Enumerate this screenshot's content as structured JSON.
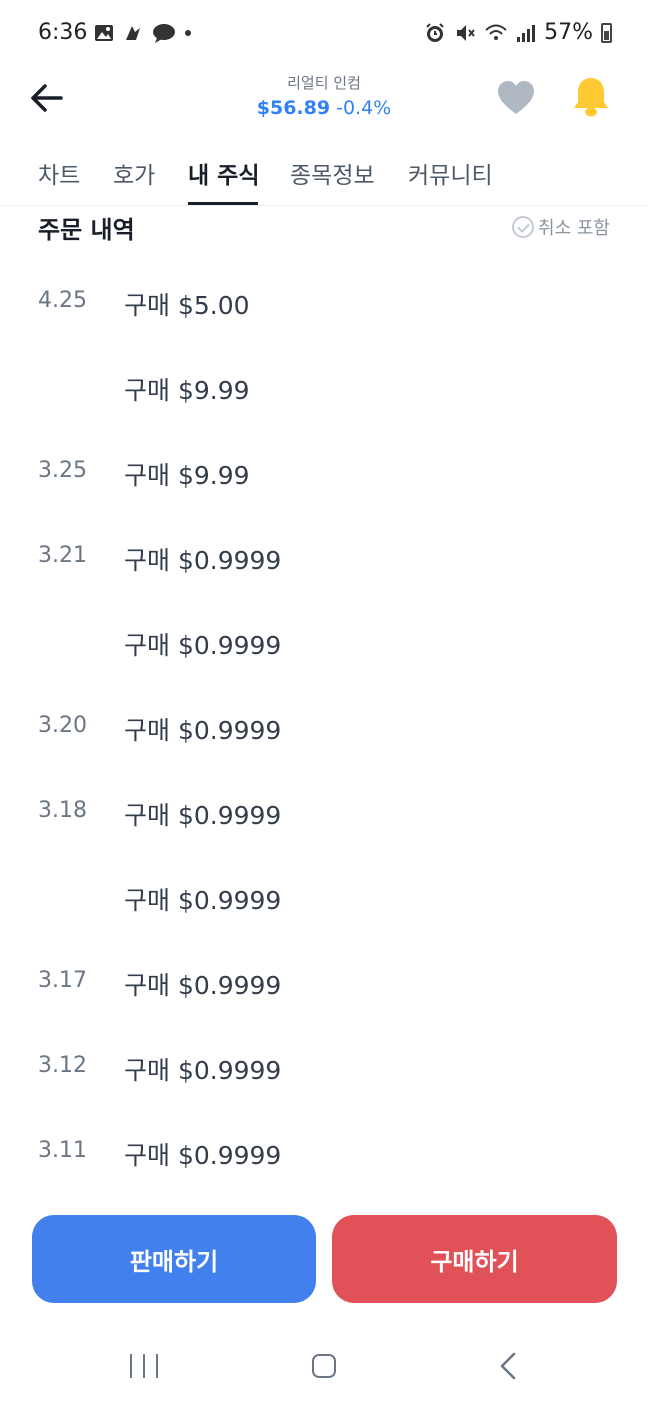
{
  "status_bar": {
    "time": "6:36",
    "battery": "57%"
  },
  "header": {
    "stock_name": "리얼티 인컴",
    "price": "$56.89",
    "change": "-0.4%",
    "price_color": "#3182f6",
    "bell_color": "#ffc933",
    "heart_color": "#b0b8c1"
  },
  "tabs": [
    {
      "label": "차트",
      "active": false
    },
    {
      "label": "호가",
      "active": false
    },
    {
      "label": "내 주식",
      "active": true
    },
    {
      "label": "종목정보",
      "active": false
    },
    {
      "label": "커뮤니티",
      "active": false
    }
  ],
  "orders": {
    "title": "주문 내역",
    "cancel_toggle_label": "취소 포함",
    "rows": [
      {
        "date": "4.25",
        "desc": "구매 $5.00"
      },
      {
        "date": "",
        "desc": "구매 $9.99"
      },
      {
        "date": "3.25",
        "desc": "구매 $9.99"
      },
      {
        "date": "3.21",
        "desc": "구매 $0.9999"
      },
      {
        "date": "",
        "desc": "구매 $0.9999"
      },
      {
        "date": "3.20",
        "desc": "구매 $0.9999"
      },
      {
        "date": "3.18",
        "desc": "구매 $0.9999"
      },
      {
        "date": "",
        "desc": "구매 $0.9999"
      },
      {
        "date": "3.17",
        "desc": "구매 $0.9999"
      },
      {
        "date": "3.12",
        "desc": "구매 $0.9999"
      },
      {
        "date": "3.11",
        "desc": "구매 $0.9999"
      }
    ]
  },
  "actions": {
    "sell_label": "판매하기",
    "buy_label": "구매하기",
    "sell_color": "#4280ed",
    "buy_color": "#e05258"
  }
}
